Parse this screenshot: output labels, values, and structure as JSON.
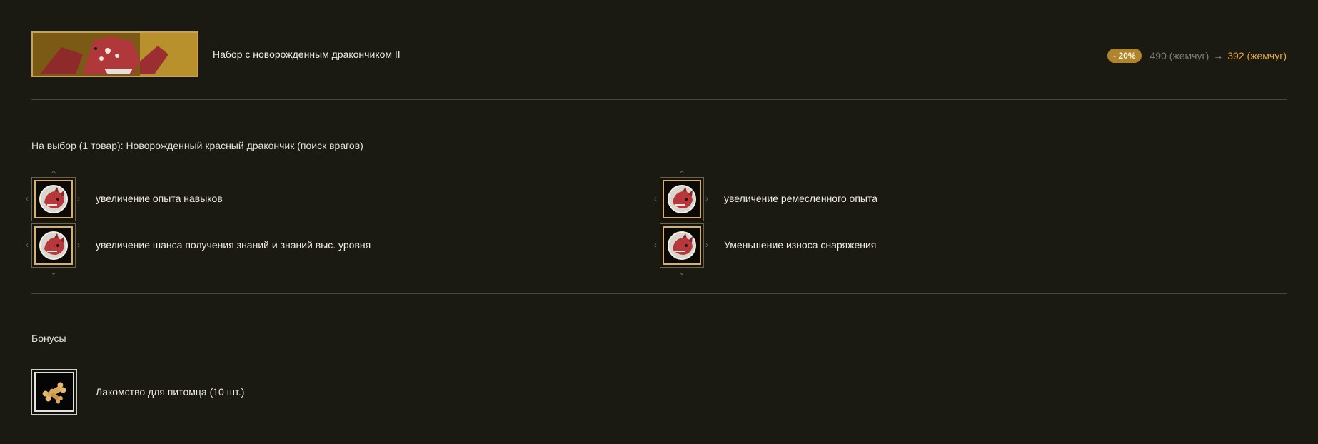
{
  "header": {
    "title": "Набор с новорожденным дракончиком II",
    "discount_badge": "- 20%",
    "old_price": "490 (жемчуг)",
    "arrow": "→",
    "new_price": "392 (жемчуг)"
  },
  "choice_section": {
    "label": "На выбор (1 товар): Новорожденный красный дракончик (поиск врагов)",
    "options": [
      {
        "label": "увеличение опыта навыков",
        "icon": "red-dragon-icon"
      },
      {
        "label": "увеличение ремесленного опыта",
        "icon": "red-dragon-icon"
      },
      {
        "label": "увеличение шанса получения знаний и знаний выс. уровня",
        "icon": "red-dragon-icon"
      },
      {
        "label": "Уменьшение износа снаряжения",
        "icon": "red-dragon-icon"
      }
    ]
  },
  "bonus_section": {
    "label": "Бонусы",
    "items": [
      {
        "label": "Лакомство для питомца (10 шт.)",
        "icon": "pet-treat-icon"
      }
    ]
  },
  "colors": {
    "background": "#1a1912",
    "accent_gold": "#c9a15e",
    "new_price": "#e7aa3e",
    "badge": "#b0842c"
  }
}
